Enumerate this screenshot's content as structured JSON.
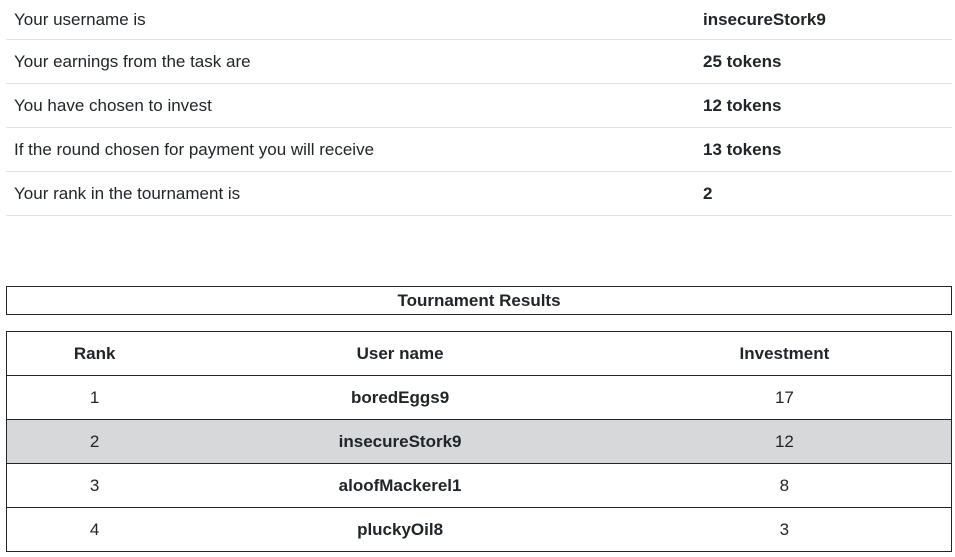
{
  "summary": {
    "rows": [
      {
        "label": "Your username is",
        "value": "insecureStork9"
      },
      {
        "label": "Your earnings from the task are",
        "value": "25 tokens"
      },
      {
        "label": "You have chosen to invest",
        "value": "12 tokens"
      },
      {
        "label": "If the round chosen for payment you will receive",
        "value": "13 tokens"
      },
      {
        "label": "Your rank in the tournament is",
        "value": "2"
      }
    ]
  },
  "results": {
    "caption": "Tournament Results",
    "headers": {
      "rank": "Rank",
      "username": "User name",
      "investment": "Investment"
    },
    "rows": [
      {
        "rank": "1",
        "username": "boredEggs9",
        "investment": "17"
      },
      {
        "rank": "2",
        "username": "insecureStork9",
        "investment": "12"
      },
      {
        "rank": "3",
        "username": "aloofMackerel1",
        "investment": "8"
      },
      {
        "rank": "4",
        "username": "pluckyOil8",
        "investment": "3"
      }
    ]
  },
  "colors": {
    "highlight_row": "#d6d8d9",
    "border": "#212529",
    "divider": "#dee2e6"
  }
}
